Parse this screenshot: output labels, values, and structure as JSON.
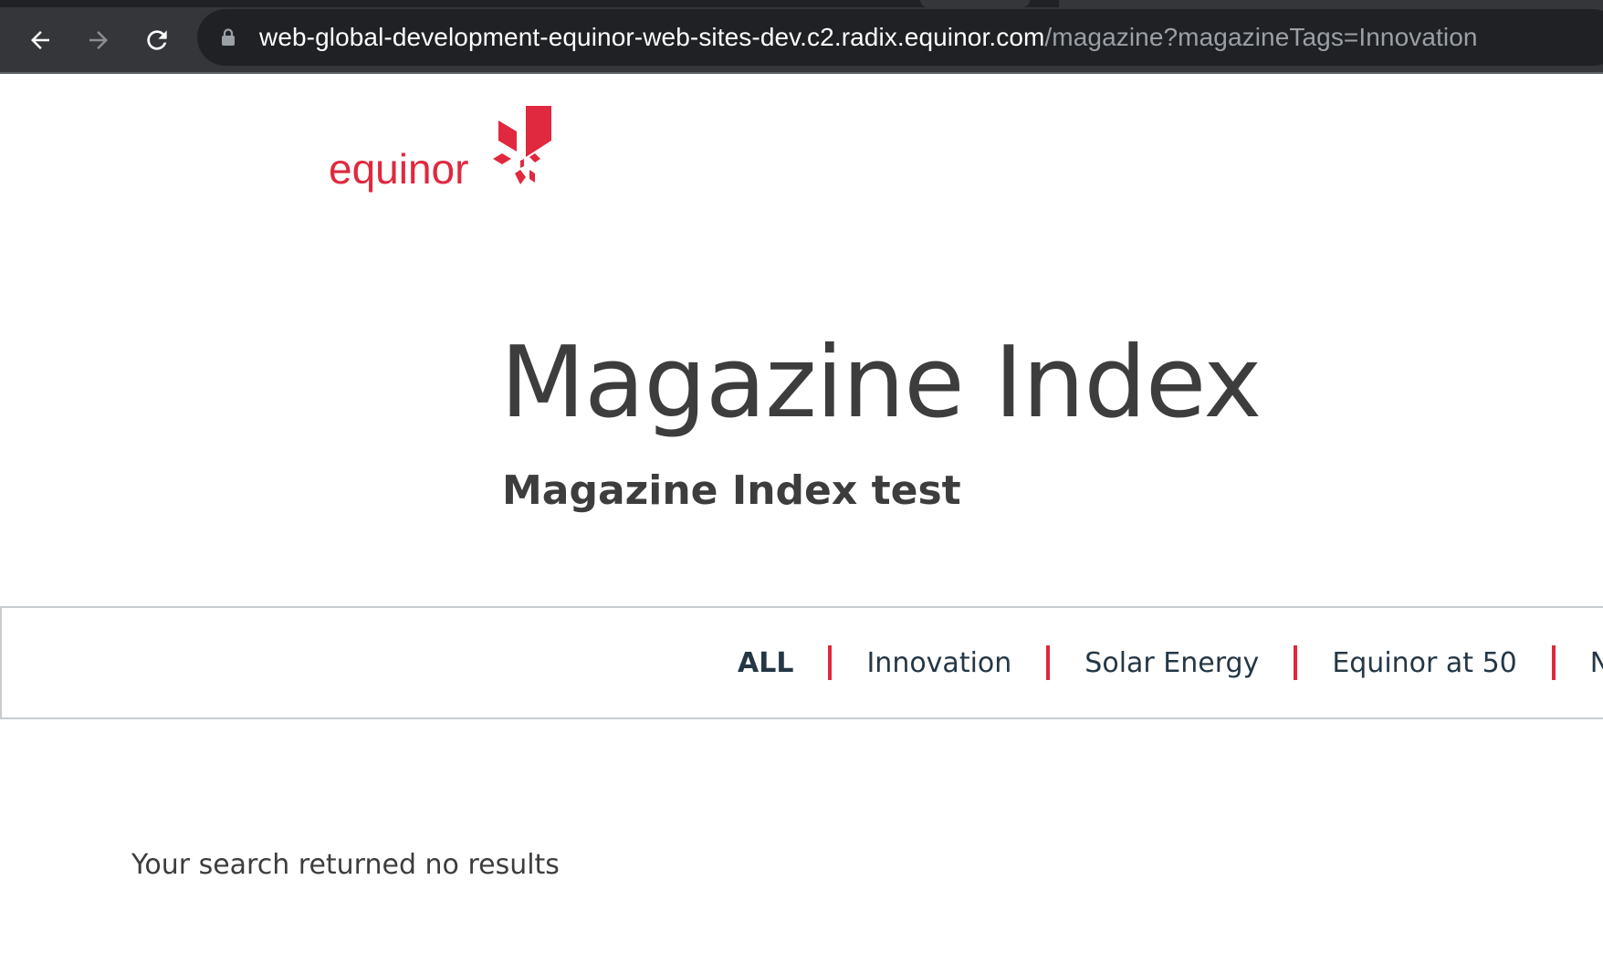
{
  "browser": {
    "url_host": "web-global-development-equinor-web-sites-dev.c2.radix.equinor.com",
    "url_path": "/magazine?magazineTags=Innovation",
    "icons": [
      "back-arrow-icon",
      "forward-arrow-icon",
      "reload-icon",
      "lock-icon"
    ]
  },
  "header": {
    "logo_text": "equinor",
    "brand_color": "#e0283e"
  },
  "main": {
    "title": "Magazine Index",
    "subtitle": "Magazine Index test"
  },
  "filters": {
    "items": [
      {
        "label": "ALL",
        "active": true
      },
      {
        "label": "Innovation",
        "active": false
      },
      {
        "label": "Solar Energy",
        "active": false
      },
      {
        "label": "Equinor at 50",
        "active": false
      },
      {
        "label": "N",
        "active": false
      }
    ],
    "separator_color": "#e0283e",
    "text_color": "#243746"
  },
  "results": {
    "empty_message": "Your search returned no results"
  }
}
